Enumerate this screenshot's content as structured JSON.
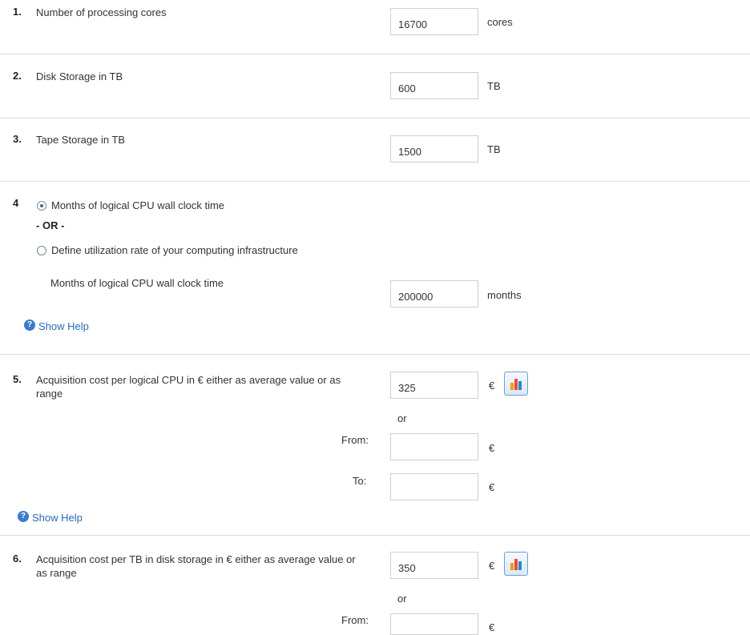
{
  "questions": [
    {
      "number": "1.",
      "label": "Number of processing cores",
      "value": "16700",
      "unit": "cores"
    },
    {
      "number": "2.",
      "label": "Disk Storage in TB",
      "value": "600",
      "unit": "TB"
    },
    {
      "number": "3.",
      "label": "Tape Storage in TB",
      "value": "1500",
      "unit": "TB"
    }
  ],
  "q4": {
    "number": "4",
    "option1": "Months of logical CPU wall clock time",
    "option1_selected": true,
    "or": "OR",
    "option2": "Define utilization rate of your computing infrastructure",
    "field_label": "Months of logical CPU wall clock time",
    "value": "200000",
    "unit": "months",
    "help": "Show Help"
  },
  "q5": {
    "number": "5.",
    "label": "Acquisition cost per logical CPU in € either as average value or as range",
    "value": "325",
    "unit": "€",
    "or": "or",
    "from_label": "From:",
    "from_value": "",
    "to_label": "To:",
    "to_value": "",
    "help": "Show Help"
  },
  "q6": {
    "number": "6.",
    "label": "Acquisition cost per TB in disk storage in € either as average value or as range",
    "value": "350",
    "unit": "€",
    "or": "or",
    "from_label": "From:",
    "from_value": ""
  },
  "icons": {
    "help": "help-icon",
    "chart": "bar-chart-icon"
  },
  "colors": {
    "link": "#2a6bb0",
    "help_icon": "#3d7cc9",
    "separator": "#dcdcdc"
  }
}
